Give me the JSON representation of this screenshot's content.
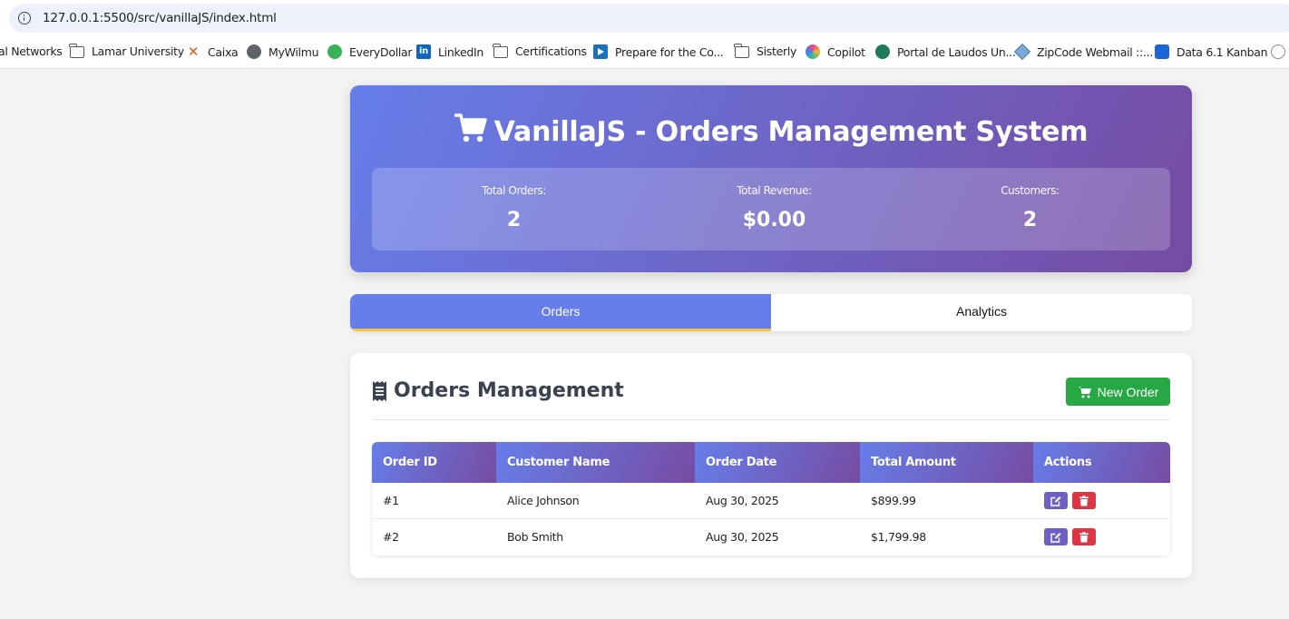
{
  "browser": {
    "url": "127.0.0.1:5500/src/vanillaJS/index.html",
    "bookmarks": [
      {
        "label": "al Networks",
        "icon": "none"
      },
      {
        "label": "Lamar University",
        "icon": "folder-icon"
      },
      {
        "label": "Caixa",
        "icon": "caixa-icon"
      },
      {
        "label": "MyWilmu",
        "icon": "globe-icon"
      },
      {
        "label": "EveryDollar",
        "icon": "everydollar-icon"
      },
      {
        "label": "LinkedIn",
        "icon": "linkedin-icon"
      },
      {
        "label": "Certifications",
        "icon": "folder-icon"
      },
      {
        "label": "Prepare for the Co...",
        "icon": "video-icon"
      },
      {
        "label": "Sisterly",
        "icon": "folder-icon"
      },
      {
        "label": "Copilot",
        "icon": "copilot-icon"
      },
      {
        "label": "Portal de Laudos Un...",
        "icon": "portal-icon"
      },
      {
        "label": "ZipCode Webmail ::...",
        "icon": "zipcode-icon"
      },
      {
        "label": "Data 6.1 Kanban",
        "icon": "kanban-icon"
      }
    ]
  },
  "header": {
    "title": "VanillaJS - Orders Management System",
    "stats": [
      {
        "label": "Total Orders:",
        "value": "2"
      },
      {
        "label": "Total Revenue:",
        "value": "$0.00"
      },
      {
        "label": "Customers:",
        "value": "2"
      }
    ]
  },
  "tabs": [
    {
      "label": "Orders",
      "active": true
    },
    {
      "label": "Analytics",
      "active": false
    }
  ],
  "orders_panel": {
    "title": "Orders Management",
    "new_order_label": "New Order",
    "columns": [
      "Order ID",
      "Customer Name",
      "Order Date",
      "Total Amount",
      "Actions"
    ],
    "rows": [
      {
        "id": "#1",
        "customer": "Alice Johnson",
        "date": "Aug 30, 2025",
        "total": "$899.99"
      },
      {
        "id": "#2",
        "customer": "Bob Smith",
        "date": "Aug 30, 2025",
        "total": "$1,799.98"
      }
    ]
  },
  "colors": {
    "gradient_start": "#667eea",
    "gradient_end": "#764ba2",
    "new_order_button": "#28a745",
    "edit_button": "#6f5fc4",
    "delete_button": "#dc3545",
    "active_tab_underline": "#f5c242"
  }
}
